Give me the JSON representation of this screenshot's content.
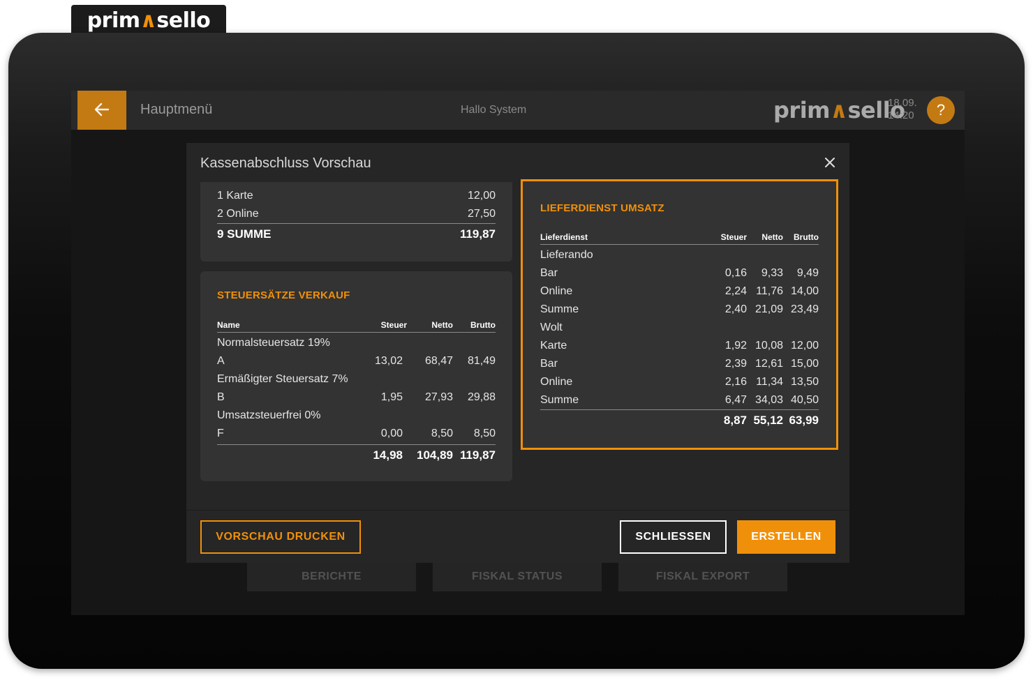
{
  "brand": {
    "logo_part1": "prim",
    "logo_mark": "∧",
    "logo_part2": "sello"
  },
  "topbar": {
    "back_icon": "arrow-left",
    "menu_title": "Hauptmenü",
    "greeting": "Hallo System",
    "date": "18.09.",
    "time": "14:20",
    "help_label": "?"
  },
  "background": {
    "buttons": [
      "BERICHTE",
      "FISKAL STATUS",
      "FISKAL EXPORT"
    ]
  },
  "modal": {
    "title": "Kassenabschluss Vorschau",
    "close_icon": "close",
    "payments": {
      "rows": [
        {
          "label": "1  Karte",
          "value": "12,00"
        },
        {
          "label": "2  Online",
          "value": "27,50"
        }
      ],
      "total": {
        "label": "9 SUMME",
        "value": "119,87"
      }
    },
    "tax_rates": {
      "title": "STEUERSÄTZE VERKAUF",
      "headers": [
        "Name",
        "Steuer",
        "Netto",
        "Brutto"
      ],
      "rows": [
        {
          "name": "Normalsteuersatz 19%",
          "steuer": "",
          "netto": "",
          "brutto": ""
        },
        {
          "name": "A",
          "steuer": "13,02",
          "netto": "68,47",
          "brutto": "81,49"
        },
        {
          "name": "Ermäßigter Steuersatz 7%",
          "steuer": "",
          "netto": "",
          "brutto": ""
        },
        {
          "name": "B",
          "steuer": "1,95",
          "netto": "27,93",
          "brutto": "29,88"
        },
        {
          "name": "Umsatzsteuerfrei 0%",
          "steuer": "",
          "netto": "",
          "brutto": ""
        },
        {
          "name": "F",
          "steuer": "0,00",
          "netto": "8,50",
          "brutto": "8,50"
        }
      ],
      "total": {
        "steuer": "14,98",
        "netto": "104,89",
        "brutto": "119,87"
      }
    },
    "delivery": {
      "title": "LIEFERDIENST UMSATZ",
      "headers": [
        "Lieferdienst",
        "Steuer",
        "Netto",
        "Brutto"
      ],
      "rows": [
        {
          "name": "Lieferando",
          "steuer": "",
          "netto": "",
          "brutto": ""
        },
        {
          "name": "Bar",
          "steuer": "0,16",
          "netto": "9,33",
          "brutto": "9,49"
        },
        {
          "name": "Online",
          "steuer": "2,24",
          "netto": "11,76",
          "brutto": "14,00"
        },
        {
          "name": "Summe",
          "steuer": "2,40",
          "netto": "21,09",
          "brutto": "23,49"
        },
        {
          "name": "Wolt",
          "steuer": "",
          "netto": "",
          "brutto": ""
        },
        {
          "name": "Karte",
          "steuer": "1,92",
          "netto": "10,08",
          "brutto": "12,00"
        },
        {
          "name": "Bar",
          "steuer": "2,39",
          "netto": "12,61",
          "brutto": "15,00"
        },
        {
          "name": "Online",
          "steuer": "2,16",
          "netto": "11,34",
          "brutto": "13,50"
        },
        {
          "name": "Summe",
          "steuer": "6,47",
          "netto": "34,03",
          "brutto": "40,50"
        }
      ],
      "total": {
        "steuer": "8,87",
        "netto": "55,12",
        "brutto": "63,99"
      }
    },
    "footer": {
      "print_label": "VORSCHAU DRUCKEN",
      "close_label": "SCHLIESSEN",
      "create_label": "ERSTELLEN"
    }
  },
  "colors": {
    "accent": "#f0900a",
    "accent_dark": "#c47a12",
    "card": "#333333",
    "modal": "#262626"
  }
}
